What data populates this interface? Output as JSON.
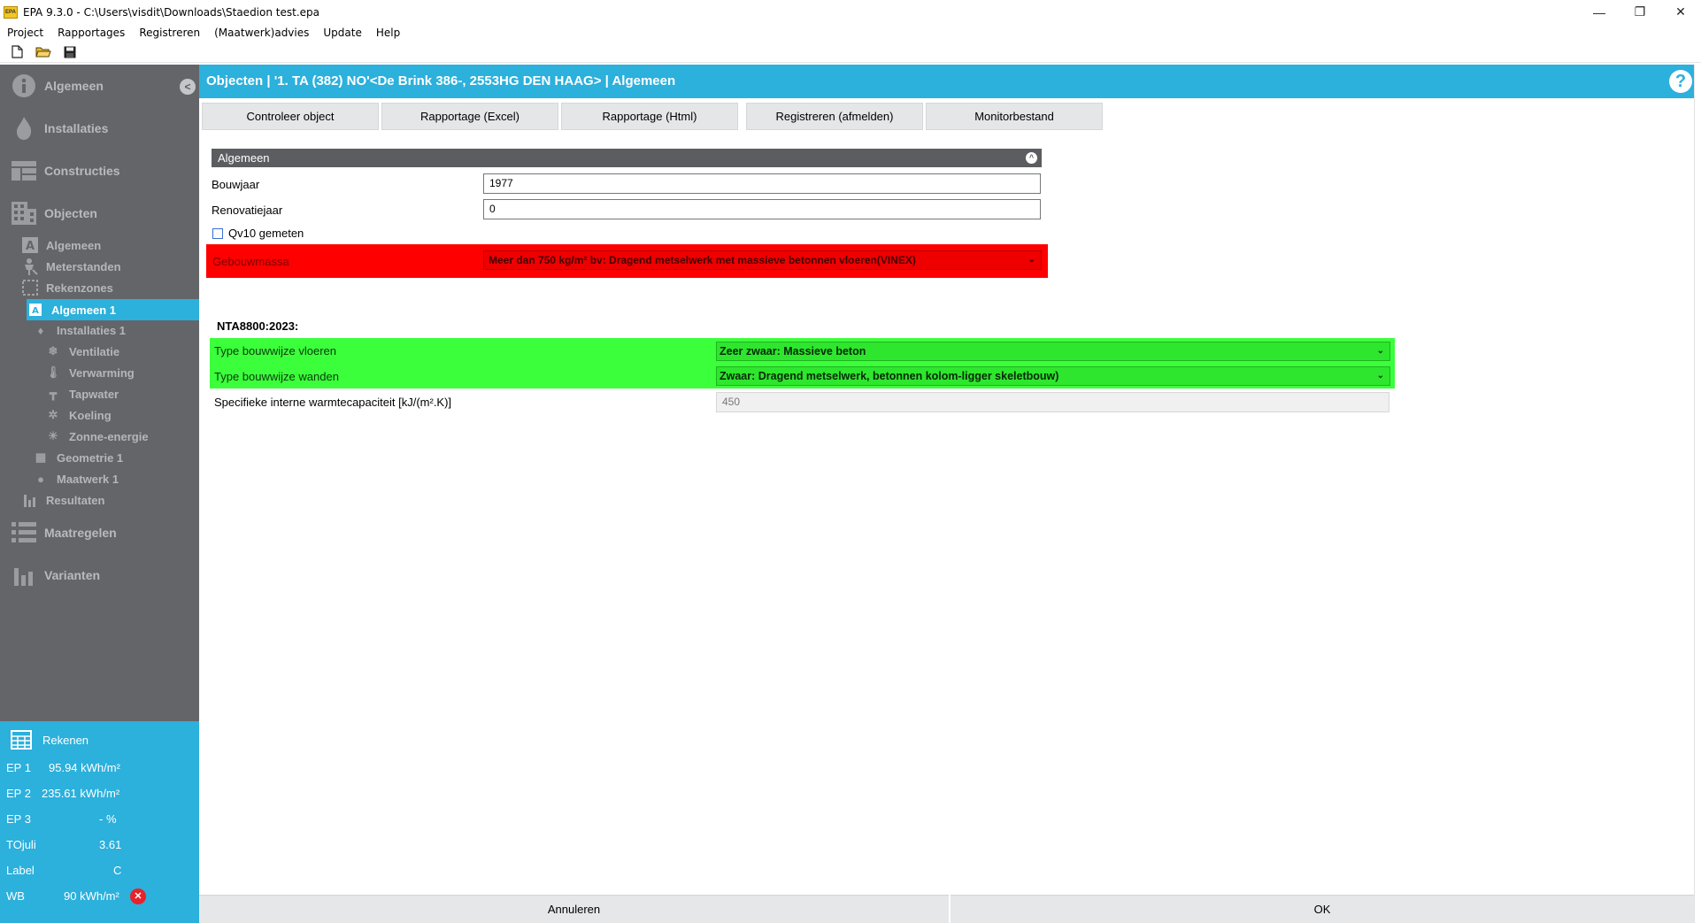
{
  "window": {
    "app_icon": "EPA",
    "title": "EPA 9.3.0 - C:\\Users\\visdit\\Downloads\\Staedion test.epa",
    "minimize_glyph": "—",
    "restore_glyph": "❐",
    "close_glyph": "✕"
  },
  "menu": [
    "Project",
    "Rapportages",
    "Registreren",
    "(Maatwerk)advies",
    "Update",
    "Help"
  ],
  "toolbar": {
    "icons": [
      "new-file-icon",
      "open-folder-icon",
      "save-icon"
    ]
  },
  "sidebar": {
    "collapse_glyph": "<",
    "main": [
      {
        "label": "Algemeen",
        "icon": "info-icon"
      },
      {
        "label": "Installaties",
        "icon": "flame-icon"
      },
      {
        "label": "Constructies",
        "icon": "grid-icon"
      },
      {
        "label": "Objecten",
        "icon": "building-icon"
      },
      {
        "label": "Maatregelen",
        "icon": "list-icon"
      },
      {
        "label": "Varianten",
        "icon": "bar-chart-icon"
      }
    ],
    "sub": [
      {
        "label": "Algemeen",
        "icon": "letter-a-icon"
      },
      {
        "label": "Meterstanden",
        "icon": "meter-icon"
      },
      {
        "label": "Rekenzones",
        "icon": "dashed-square-icon"
      },
      {
        "label": "Algemeen 1",
        "icon": "letter-a-icon",
        "active": true
      },
      {
        "label": "Installaties 1",
        "icon": "flame-icon"
      },
      {
        "label": "Ventilatie",
        "icon": "ventilation-icon"
      },
      {
        "label": "Verwarming",
        "icon": "thermometer-icon"
      },
      {
        "label": "Tapwater",
        "icon": "faucet-icon"
      },
      {
        "label": "Koeling",
        "icon": "snowflake-icon"
      },
      {
        "label": "Zonne-energie",
        "icon": "sun-icon"
      },
      {
        "label": "Geometrie 1",
        "icon": "grid-icon"
      },
      {
        "label": "Maatwerk 1",
        "icon": "person-icon"
      },
      {
        "label": "Resultaten",
        "icon": "bar-chart-icon"
      }
    ]
  },
  "results": {
    "rekenen_label": "Rekenen",
    "rows": [
      {
        "label": "EP 1",
        "value": "95.94 kWh/m²"
      },
      {
        "label": "EP 2",
        "value": "235.61 kWh/m²"
      },
      {
        "label": "EP 3",
        "value": "-  %"
      },
      {
        "label": "TOjuli",
        "value": "3.61"
      },
      {
        "label": "Label",
        "value": "C"
      },
      {
        "label": "WB",
        "value": "90 kWh/m²"
      }
    ],
    "error_glyph": "✕"
  },
  "header": {
    "title": "Objecten | '1. TA (382) NO'<De Brink 386-, 2553HG DEN HAAG> | Algemeen",
    "help_glyph": "?"
  },
  "actions": [
    "Controleer object",
    "Rapportage (Excel)",
    "Rapportage (Html)",
    "Registreren (afmelden)",
    "Monitorbestand"
  ],
  "algemeen": {
    "section_title": "Algemeen",
    "collapse_glyph": "^",
    "bouwjaar_label": "Bouwjaar",
    "bouwjaar_value": "1977",
    "renovatiejaar_label": "Renovatiejaar",
    "renovatiejaar_value": "0",
    "qv10_label": "Qv10 gemeten",
    "gebouwmassa_label": "Gebouwmassa",
    "gebouwmassa_value": "Meer dan 750 kg/m² bv: Dragend metselwerk met massieve betonnen vloeren(VINEX)"
  },
  "nta": {
    "heading": "NTA8800:2023:",
    "vloeren_label": "Type bouwwijze vloeren",
    "vloeren_value": "Zeer zwaar: Massieve beton",
    "wanden_label": "Type bouwwijze wanden",
    "wanden_value": "Zwaar: Dragend metselwerk, betonnen kolom-ligger skeletbouw)",
    "capaciteit_label": "Specifieke interne warmtecapaciteit [kJ/(m².K)]",
    "capaciteit_value": "450"
  },
  "footer": {
    "cancel_label": "Annuleren",
    "ok_label": "OK"
  },
  "chevron_glyph": "⌄",
  "colors": {
    "accent": "#2cb0dc",
    "sidebar": "#646569",
    "error_row": "#ff0000",
    "ok_row": "#3cff3c"
  }
}
